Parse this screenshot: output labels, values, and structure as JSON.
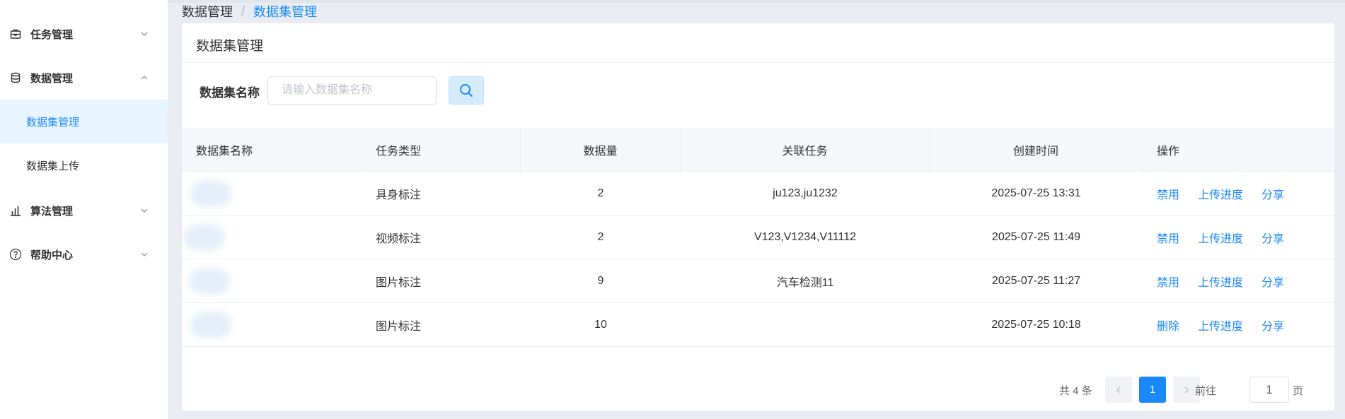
{
  "sidebar": {
    "items": [
      {
        "label": "任务管理",
        "icon": "briefcase-icon"
      },
      {
        "label": "数据管理",
        "icon": "database-icon"
      },
      {
        "label": "算法管理",
        "icon": "bar-chart-icon"
      },
      {
        "label": "帮助中心",
        "icon": "help-circle-icon"
      }
    ],
    "sub_items": [
      {
        "label": "数据集管理",
        "active": true
      },
      {
        "label": "数据集上传",
        "active": false
      }
    ]
  },
  "breadcrumb": {
    "parent": "数据管理",
    "separator": "/",
    "current": "数据集管理"
  },
  "card": {
    "title": "数据集管理"
  },
  "search": {
    "label": "数据集名称",
    "placeholder": "请输入数据集名称",
    "value": ""
  },
  "table": {
    "headers": [
      "数据集名称",
      "任务类型",
      "数据量",
      "关联任务",
      "创建时间",
      "操作"
    ],
    "rows": [
      {
        "task_type": "具身标注",
        "count": "2",
        "linked": "ju123,ju1232",
        "created": "2025-07-25 13:31",
        "op1": "禁用",
        "op2": "上传进度",
        "op3": "分享"
      },
      {
        "task_type": "视频标注",
        "count": "2",
        "linked": "V123,V1234,V11112",
        "created": "2025-07-25 11:49",
        "op1": "禁用",
        "op2": "上传进度",
        "op3": "分享"
      },
      {
        "task_type": "图片标注",
        "count": "9",
        "linked": "汽车检测11",
        "created": "2025-07-25 11:27",
        "op1": "禁用",
        "op2": "上传进度",
        "op3": "分享"
      },
      {
        "task_type": "图片标注",
        "count": "10",
        "linked": "",
        "created": "2025-07-25 10:18",
        "op1": "删除",
        "op2": "上传进度",
        "op3": "分享"
      }
    ]
  },
  "pagination": {
    "total_text": "共 4 条",
    "current_page": "1",
    "goto_label": "前往",
    "goto_value": "1",
    "page_suffix": "页"
  },
  "colors": {
    "accent": "#1989fa",
    "active_bg": "#e8f4ff",
    "header_bg": "#f5f7fa"
  }
}
